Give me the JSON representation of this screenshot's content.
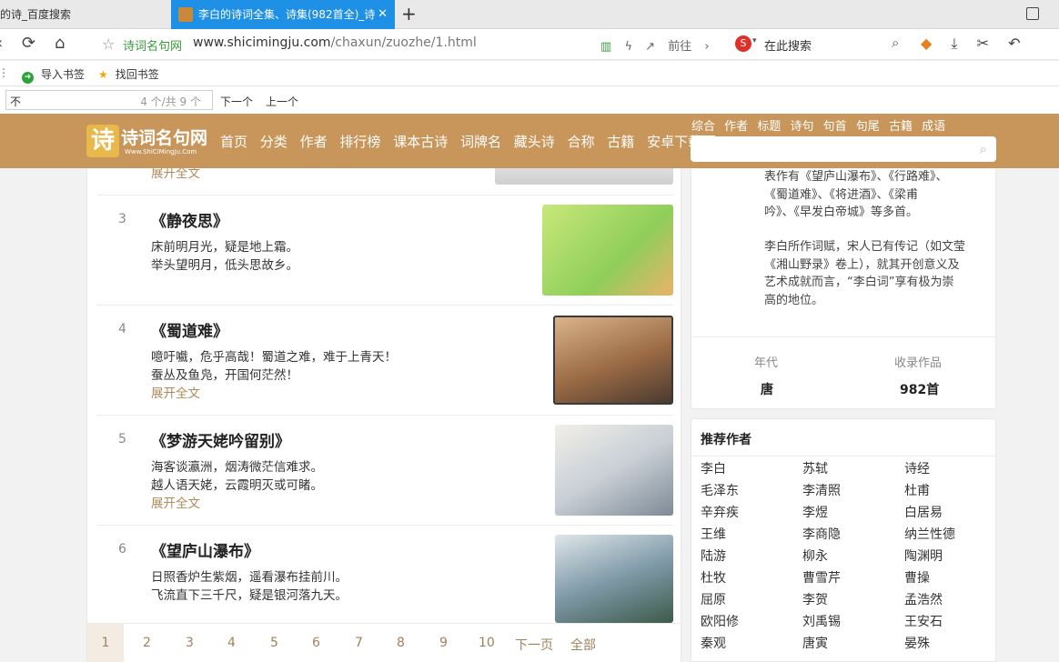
{
  "browser": {
    "tabs": [
      {
        "label": "的诗_百度搜索"
      },
      {
        "label": "李白的诗词全集、诗集(982首全)_诗",
        "close": "✕"
      }
    ],
    "new_tab": "+",
    "address": {
      "site_name": "诗词名句网",
      "url_host": "www.shicimingju.com",
      "url_path": "/chaxun/zuozhe/1.html",
      "go_label": "前往",
      "search_placeholder": "在此搜索"
    },
    "bookmarks": [
      "导入书签",
      "找回书签"
    ],
    "find": {
      "query": "不",
      "count": "4 个/共 9 个",
      "next": "下一个",
      "prev": "上一个"
    }
  },
  "site": {
    "logo_name": "诗词名句网",
    "logo_sub": "Www.ShiCiMingJu.Com",
    "nav": [
      "首页",
      "分类",
      "作者",
      "排行榜",
      "课本古诗",
      "词牌名",
      "藏头诗",
      "合称",
      "古籍",
      "安卓下载"
    ],
    "search_tabs": [
      "综合",
      "作者",
      "标题",
      "诗句",
      "句首",
      "句尾",
      "古籍",
      "成语"
    ]
  },
  "poems": [
    {
      "more": "展开全文"
    },
    {
      "num": "3",
      "title": "《静夜思》",
      "lines": [
        "床前明月光，疑是地上霜。",
        "举头望明月，低头思故乡。"
      ]
    },
    {
      "num": "4",
      "title": "《蜀道难》",
      "lines": [
        "噫吁嚱，危乎高哉！蜀道之难，难于上青天！",
        "蚕丛及鱼凫，开国何茫然！"
      ],
      "more": "展开全文"
    },
    {
      "num": "5",
      "title": "《梦游天姥吟留别》",
      "lines": [
        "海客谈瀛洲，烟涛微茫信难求。",
        "越人语天姥，云霞明灭或可睹。"
      ],
      "more": "展开全文"
    },
    {
      "num": "6",
      "title": "《望庐山瀑布》",
      "lines": [
        "日照香炉生紫烟，遥看瀑布挂前川。",
        "飞流直下三千尺，疑是银河落九天。"
      ]
    }
  ],
  "pager": {
    "pages": [
      "1",
      "2",
      "3",
      "4",
      "5",
      "6",
      "7",
      "8",
      "9",
      "10"
    ],
    "next": "下一页",
    "all": "全部"
  },
  "author_info": {
    "bio1": [
      "表作有《望庐山瀑布》、《行路难》、",
      "《蜀道难》、《将进酒》、《梁甫",
      "吟》、《早发白帝城》等多首。"
    ],
    "bio2": [
      "李白所作词赋，宋人已有传记（如文莹",
      "《湘山野录》卷上），就其开创意义及",
      "艺术成就而言，“李白词”享有极为崇",
      "高的地位。"
    ],
    "era_label": "年代",
    "era_value": "唐",
    "works_label": "收录作品",
    "works_value": "982首"
  },
  "recommended": {
    "title": "推荐作者",
    "authors": [
      "李白",
      "苏轼",
      "诗经",
      "毛泽东",
      "李清照",
      "杜甫",
      "辛弃疾",
      "李煜",
      "白居易",
      "王维",
      "李商隐",
      "纳兰性德",
      "陆游",
      "柳永",
      "陶渊明",
      "杜牧",
      "曹雪芹",
      "曹操",
      "屈原",
      "李贺",
      "孟浩然",
      "欧阳修",
      "刘禹锡",
      "王安石",
      "秦观",
      "唐寅",
      "晏殊"
    ]
  },
  "colors": {
    "header_bg": "#c8955a",
    "tab_active": "#1e90e6",
    "link_brown": "#b08a5a"
  }
}
